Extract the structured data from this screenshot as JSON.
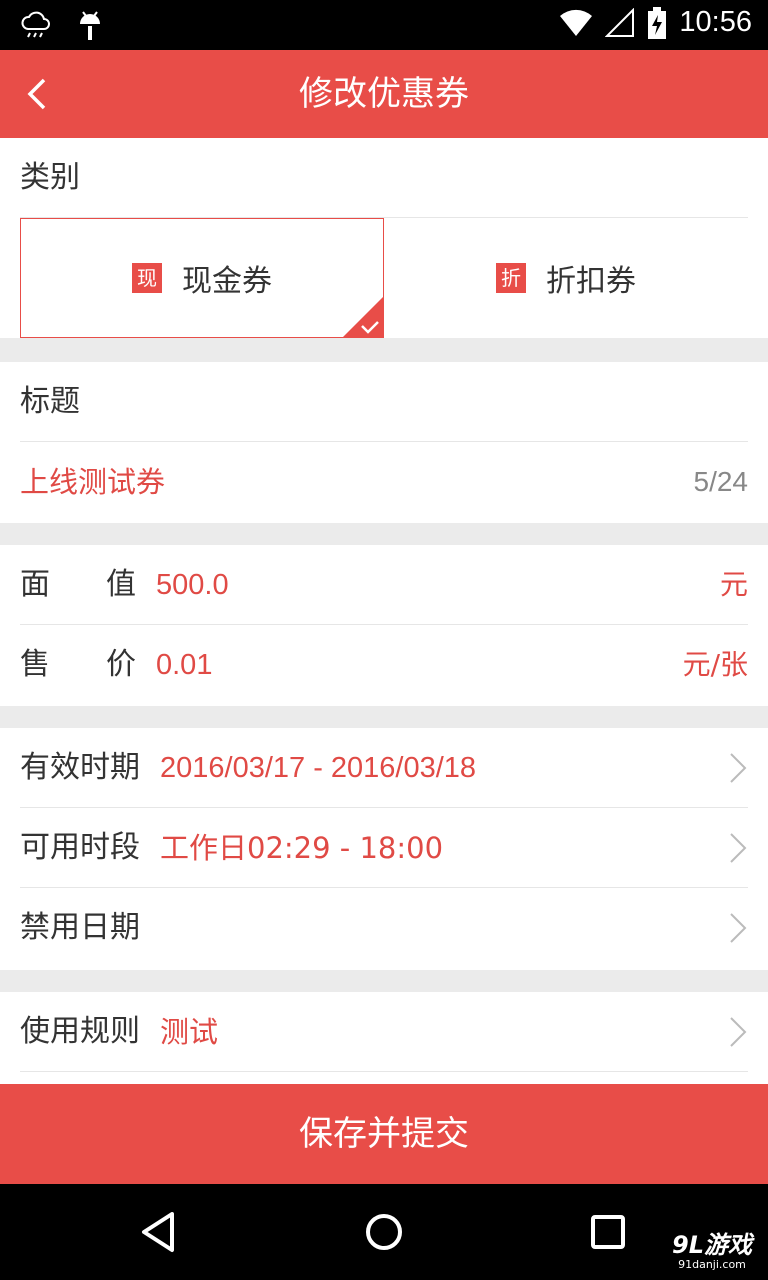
{
  "status_bar": {
    "time": "10:56"
  },
  "app_bar": {
    "title": "修改优惠券"
  },
  "category": {
    "label": "类别",
    "options": [
      {
        "badge": "现",
        "label": "现金券",
        "selected": true
      },
      {
        "badge": "折",
        "label": "折扣券",
        "selected": false
      }
    ]
  },
  "title_section": {
    "label": "标题",
    "value": "上线测试券",
    "counter": "5/24"
  },
  "face_value": {
    "label_a": "面",
    "label_b": "值",
    "value": "500.0",
    "unit": "元"
  },
  "price": {
    "label_a": "售",
    "label_b": "价",
    "value": "0.01",
    "unit": "元/张"
  },
  "validity": {
    "label": "有效时期",
    "value": "2016/03/17 - 2016/03/18"
  },
  "available_time": {
    "label": "可用时段",
    "value": "工作日02:29 - 18:00"
  },
  "blackout": {
    "label": "禁用日期",
    "value": ""
  },
  "rules": {
    "label": "使用规则",
    "value": "测试"
  },
  "submit": {
    "label": "保存并提交"
  },
  "watermark": {
    "line1": "9L游戏",
    "line2": "91danji.com"
  },
  "colors": {
    "accent": "#e84d48",
    "value_text": "#e04a45"
  }
}
